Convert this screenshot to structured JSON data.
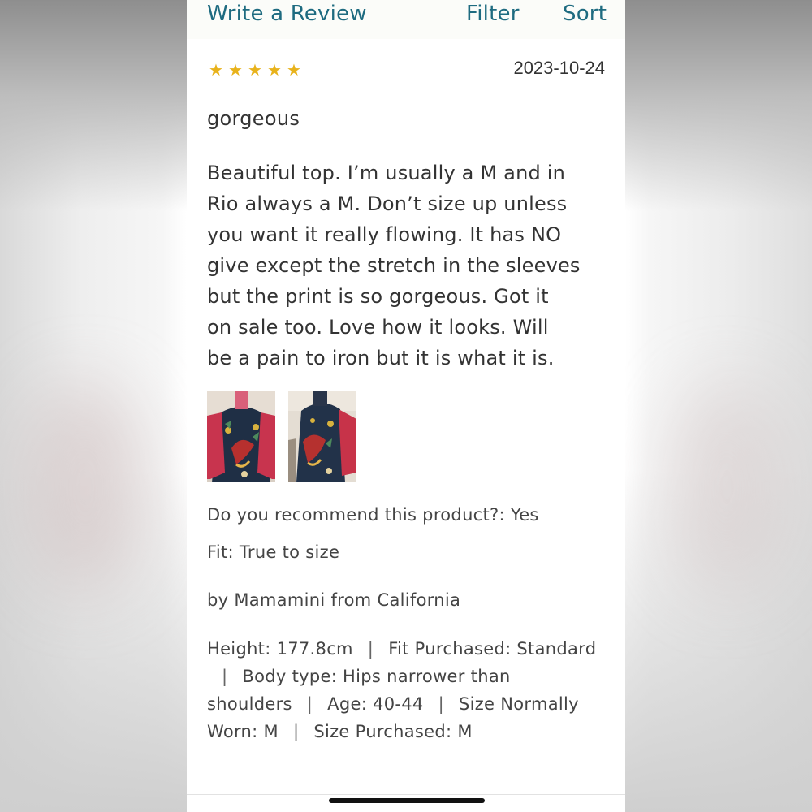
{
  "toolbar": {
    "write_review": "Write a Review",
    "filter": "Filter",
    "sort": "Sort"
  },
  "review": {
    "rating": 5,
    "rating_max": 5,
    "star_glyph": "★",
    "star_color": "#e8b21a",
    "date": "2023-10-24",
    "title": "gorgeous",
    "body": "Beautiful top. I’m usually a M and in\nRio always a M. Don’t size up unless\nyou want it really flowing. It has NO\ngive except the stretch in the sleeves\nbut the print is so gorgeous. Got it\non sale too. Love how it looks. Will\nbe a pain to iron but it is what it is.",
    "photos": [
      {
        "icon": "review-photo"
      },
      {
        "icon": "review-photo"
      }
    ],
    "recommend": "Do you recommend this product?: Yes",
    "fit": "Fit: True to size",
    "author": "by Mamamini from California",
    "details": [
      "Height: 177.8cm",
      "Fit Purchased: Standard",
      "Body type: Hips narrower than shoulders",
      "Age: 40-44",
      "Size Normally Worn: M",
      "Size Purchased: M"
    ],
    "detail_separator": "|"
  },
  "colors": {
    "link": "#1e6b80",
    "text": "#333333"
  }
}
